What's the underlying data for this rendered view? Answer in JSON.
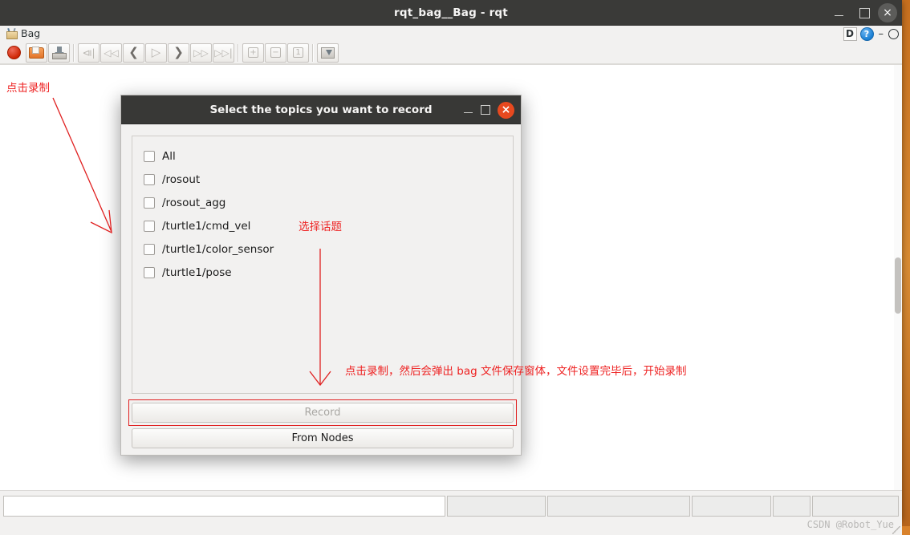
{
  "window": {
    "title": "rqt_bag__Bag - rqt",
    "controls": {
      "minimize": "minimize-icon",
      "maximize": "maximize-icon",
      "close": "×"
    }
  },
  "menubar": {
    "items": [
      {
        "label": "Bag",
        "icon": "bag-icon"
      }
    ],
    "right": {
      "dock_label": "D",
      "help_label": "?",
      "float_label": "–",
      "undock_label": "undock-icon"
    }
  },
  "toolbar": {
    "buttons": [
      {
        "name": "record-button",
        "icon": "record-dot-icon",
        "enabled": true
      },
      {
        "name": "open-bag-button",
        "icon": "folder-icon",
        "enabled": true
      },
      {
        "name": "save-bag-button",
        "icon": "save-icon",
        "enabled": true
      },
      {
        "name": "first-frame-button",
        "icon": "skip-to-start-icon",
        "glyph": "⧏|",
        "enabled": false
      },
      {
        "name": "fast-rewind-button",
        "icon": "rewind-icon",
        "glyph": "◁◁",
        "enabled": false
      },
      {
        "name": "step-back-button",
        "icon": "previous-icon",
        "glyph": "❮",
        "enabled": false
      },
      {
        "name": "play-button",
        "icon": "play-icon",
        "glyph": "▷",
        "enabled": false
      },
      {
        "name": "step-forward-button",
        "icon": "next-icon",
        "glyph": "❯",
        "enabled": false
      },
      {
        "name": "fast-forward-button",
        "icon": "forward-icon",
        "glyph": "▷▷",
        "enabled": false
      },
      {
        "name": "last-frame-button",
        "icon": "skip-to-end-icon",
        "glyph": "▷▷|",
        "enabled": false
      },
      {
        "name": "zoom-in-button",
        "icon": "zoom-in-icon",
        "glyph": "+",
        "enabled": false
      },
      {
        "name": "zoom-out-button",
        "icon": "zoom-out-icon",
        "glyph": "−",
        "enabled": false
      },
      {
        "name": "zoom-reset-button",
        "icon": "zoom-reset-icon",
        "glyph": "1",
        "enabled": false
      },
      {
        "name": "screenshot-button",
        "icon": "screenshot-icon",
        "enabled": true
      }
    ]
  },
  "dialog": {
    "title": "Select the topics you want to record",
    "controls": {
      "minimize": "minimize-icon",
      "maximize": "maximize-icon",
      "close": "×"
    },
    "topics": [
      {
        "label": "All",
        "checked": false
      },
      {
        "label": "/rosout",
        "checked": false
      },
      {
        "label": "/rosout_agg",
        "checked": false
      },
      {
        "label": "/turtle1/cmd_vel",
        "checked": false
      },
      {
        "label": "/turtle1/color_sensor",
        "checked": false
      },
      {
        "label": "/turtle1/pose",
        "checked": false
      }
    ],
    "record_button": {
      "label": "Record",
      "enabled": false
    },
    "from_nodes_button": {
      "label": "From Nodes",
      "enabled": true
    }
  },
  "annotations": {
    "click_record": "点击录制",
    "select_topic": "选择话题",
    "record_hint": "点击录制，然后会弹出 bag 文件保存窗体，文件设置完毕后，开始录制",
    "color": "#ee2222"
  },
  "statusbar": {
    "watermark": "CSDN @Robot_Yue",
    "cells": [
      "",
      "",
      "",
      "",
      "",
      ""
    ]
  }
}
